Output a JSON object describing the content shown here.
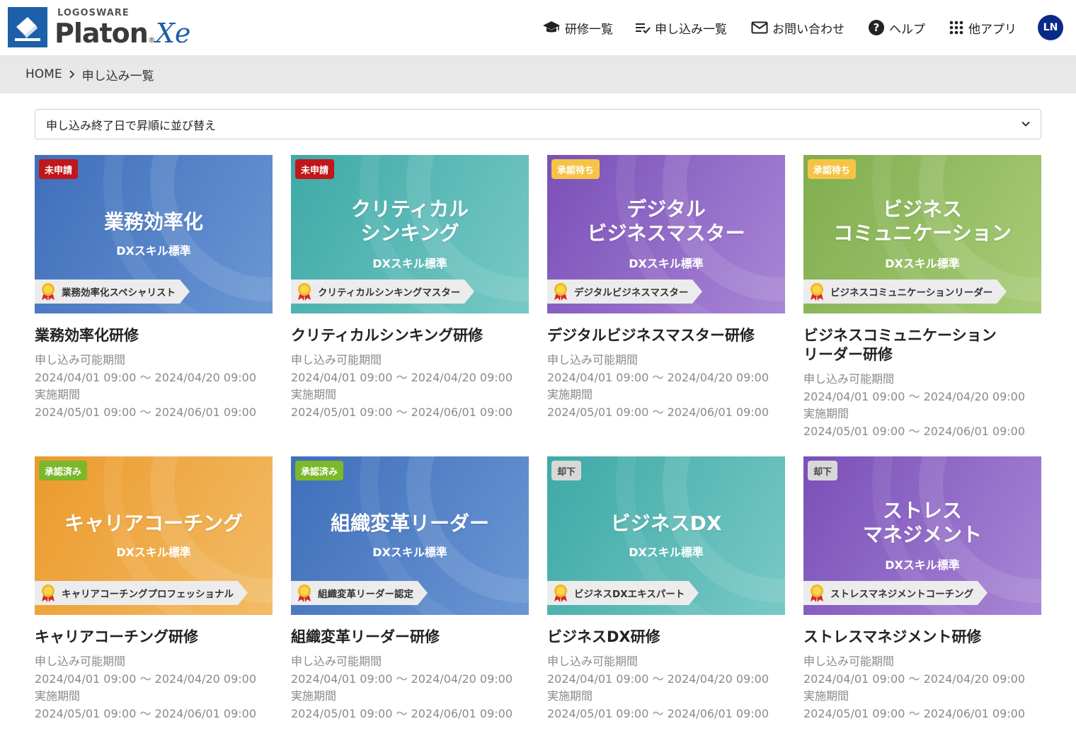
{
  "header": {
    "logo_small": "LOGOSWARE",
    "logo_brand": "Platon",
    "logo_reg": "®",
    "logo_xe": "Xe",
    "nav": [
      {
        "label": "研修一覧",
        "icon": "graduation-cap-icon"
      },
      {
        "label": "申し込み一覧",
        "icon": "list-check-icon"
      },
      {
        "label": "お問い合わせ",
        "icon": "mail-icon"
      },
      {
        "label": "ヘルプ",
        "icon": "help-circle-icon"
      },
      {
        "label": "他アプリ",
        "icon": "apps-grid-icon"
      }
    ],
    "avatar_initials": "LN"
  },
  "breadcrumb": {
    "home": "HOME",
    "current": "申し込み一覧"
  },
  "sort": {
    "selected": "申し込み終了日で昇順に並び替え"
  },
  "labels": {
    "apply_period": "申し込み可能期間",
    "impl_period": "実施期間"
  },
  "cards": [
    {
      "status": "未申請",
      "status_color": "#c0171b",
      "status_text_color": "#ffffff",
      "thumb_lines": [
        "業務効率化"
      ],
      "thumb_sub": "DXスキル標準",
      "ribbon": "業務効率化スペシャリスト",
      "bg_from": "#3f6fbb",
      "bg_to": "#6a96d4",
      "title": "業務効率化研修",
      "apply": "2024/04/01 09:00 〜 2024/04/20 09:00",
      "impl": "2024/05/01 09:00 〜 2024/06/01 09:00"
    },
    {
      "status": "未申請",
      "status_color": "#c0171b",
      "status_text_color": "#ffffff",
      "thumb_lines": [
        "クリティカル",
        "シンキング"
      ],
      "thumb_sub": "DXスキル標準",
      "ribbon": "クリティカルシンキングマスター",
      "bg_from": "#3ea9a6",
      "bg_to": "#78c9c6",
      "title": "クリティカルシンキング研修",
      "apply": "2024/04/01 09:00 〜 2024/04/20 09:00",
      "impl": "2024/05/01 09:00 〜 2024/06/01 09:00"
    },
    {
      "status": "承認待ち",
      "status_color": "#f6c445",
      "status_text_color": "#ffffff",
      "thumb_lines": [
        "デジタル",
        "ビジネスマスター"
      ],
      "thumb_sub": "DXスキル標準",
      "ribbon": "デジタルビジネスマスター",
      "bg_from": "#7a4fb8",
      "bg_to": "#a986d6",
      "title": "デジタルビジネスマスター研修",
      "apply": "2024/04/01 09:00 〜 2024/04/20 09:00",
      "impl": "2024/05/01 09:00 〜 2024/06/01 09:00"
    },
    {
      "status": "承認待ち",
      "status_color": "#f6c445",
      "status_text_color": "#ffffff",
      "thumb_lines": [
        "ビジネス",
        "コミュニケーション"
      ],
      "thumb_sub": "DXスキル標準",
      "ribbon": "ビジネスコミュニケーションリーダー",
      "bg_from": "#80ad4e",
      "bg_to": "#a8cc78",
      "title": "ビジネスコミュニケーション\nリーダー研修",
      "title_lines": [
        "ビジネスコミュニケーション",
        "リーダー研修"
      ],
      "apply": "2024/04/01 09:00 〜 2024/04/20 09:00",
      "impl": "2024/05/01 09:00 〜 2024/06/01 09:00"
    },
    {
      "status": "承認済み",
      "status_color": "#7bb82a",
      "status_text_color": "#ffffff",
      "thumb_lines": [
        "キャリアコーチング"
      ],
      "thumb_sub": "DXスキル標準",
      "ribbon": "キャリアコーチングプロフェッショナル",
      "bg_from": "#ec9a2c",
      "bg_to": "#f2bc66",
      "title": "キャリアコーチング研修",
      "apply": "2024/04/01 09:00 〜 2024/04/20 09:00",
      "impl": "2024/05/01 09:00 〜 2024/06/01 09:00"
    },
    {
      "status": "承認済み",
      "status_color": "#7bb82a",
      "status_text_color": "#ffffff",
      "thumb_lines": [
        "組織変革リーダー"
      ],
      "thumb_sub": "DXスキル標準",
      "ribbon": "組織変革リーダー認定",
      "bg_from": "#3f6fbb",
      "bg_to": "#6a96d4",
      "title": "組織変革リーダー研修",
      "apply": "2024/04/01 09:00 〜 2024/04/20 09:00",
      "impl": "2024/05/01 09:00 〜 2024/06/01 09:00"
    },
    {
      "status": "却下",
      "status_color": "#d8d8d8",
      "status_text_color": "#444444",
      "thumb_lines": [
        "ビジネスDX"
      ],
      "thumb_sub": "DXスキル標準",
      "ribbon": "ビジネスDXエキスパート",
      "bg_from": "#3ea9a6",
      "bg_to": "#78c9c6",
      "title": "ビジネスDX研修",
      "apply": "2024/04/01 09:00 〜 2024/04/20 09:00",
      "impl": "2024/05/01 09:00 〜 2024/06/01 09:00"
    },
    {
      "status": "却下",
      "status_color": "#d8d8d8",
      "status_text_color": "#444444",
      "thumb_lines": [
        "ストレス",
        "マネジメント"
      ],
      "thumb_sub": "DXスキル標準",
      "ribbon": "ストレスマネジメントコーチング",
      "bg_from": "#7a4fb8",
      "bg_to": "#a986d6",
      "title": "ストレスマネジメント研修",
      "apply": "2024/04/01 09:00 〜 2024/04/20 09:00",
      "impl": "2024/05/01 09:00 〜 2024/06/01 09:00"
    }
  ]
}
